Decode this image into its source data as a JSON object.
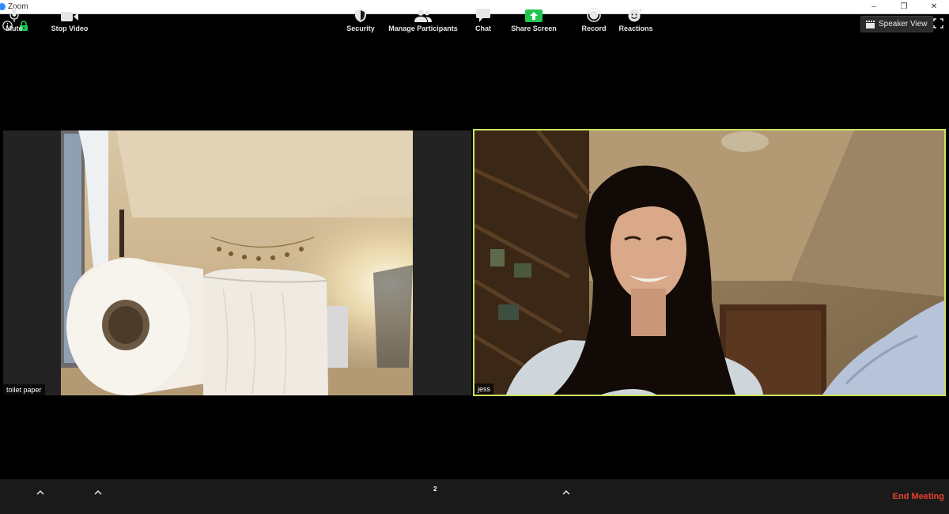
{
  "window": {
    "title": "Zoom",
    "controls": {
      "minimize": "–",
      "restore": "❐",
      "close": "✕"
    }
  },
  "header": {
    "speaker_view_label": "Speaker View"
  },
  "participants": [
    {
      "name": "toilet paper",
      "active_speaker": false
    },
    {
      "name": "jess",
      "active_speaker": true
    }
  ],
  "toolbar": {
    "mute_label": "Mute",
    "stop_video_label": "Stop Video",
    "security_label": "Security",
    "manage_participants_label": "Manage Participants",
    "participant_count": "2",
    "chat_label": "Chat",
    "share_screen_label": "Share Screen",
    "record_label": "Record",
    "reactions_label": "Reactions",
    "end_meeting_label": "End Meeting"
  },
  "colors": {
    "active_speaker_border": "#cbe35f",
    "share_screen_green": "#23c552",
    "end_meeting_red": "#e8412f",
    "lock_green": "#23c552"
  }
}
